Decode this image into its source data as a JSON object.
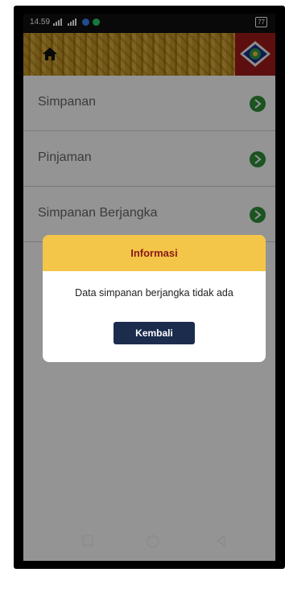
{
  "status_bar": {
    "time": "14.59",
    "battery": "77"
  },
  "menu": {
    "items": [
      {
        "label": "Simpanan"
      },
      {
        "label": "Pinjaman"
      },
      {
        "label": "Simpanan Berjangka"
      }
    ]
  },
  "dialog": {
    "title": "Informasi",
    "message": "Data simpanan berjangka tidak ada",
    "button_label": "Kembali"
  },
  "colors": {
    "dialog_header": "#f3c548",
    "dialog_title": "#8b1a1a",
    "button": "#1b2c4d",
    "chevron": "#2f8f3a"
  },
  "icons": [
    "home-icon",
    "chevron-right-icon",
    "recent-apps-icon",
    "home-nav-icon",
    "back-icon"
  ]
}
